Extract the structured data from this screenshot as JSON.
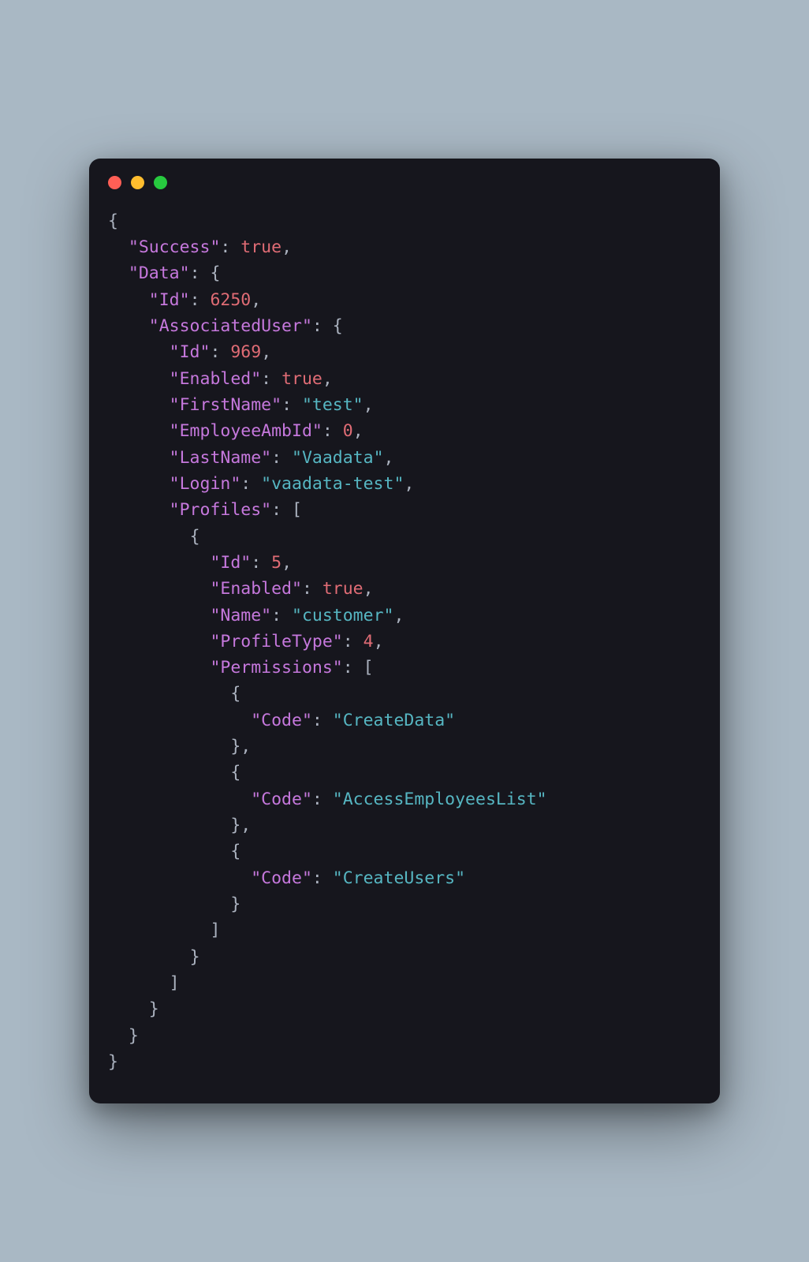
{
  "keys": {
    "success": "\"Success\"",
    "data": "\"Data\"",
    "id": "\"Id\"",
    "associatedUser": "\"AssociatedUser\"",
    "enabled": "\"Enabled\"",
    "firstName": "\"FirstName\"",
    "employeeAmbId": "\"EmployeeAmbId\"",
    "lastName": "\"LastName\"",
    "login": "\"Login\"",
    "profiles": "\"Profiles\"",
    "name": "\"Name\"",
    "profileType": "\"ProfileType\"",
    "permissions": "\"Permissions\"",
    "code": "\"Code\""
  },
  "vals": {
    "true": "true",
    "id1": "6250",
    "id2": "969",
    "firstName": "\"test\"",
    "zero": "0",
    "lastName": "\"Vaadata\"",
    "login": "\"vaadata-test\"",
    "profileId": "5",
    "customer": "\"customer\"",
    "profileType": "4",
    "perm1": "\"CreateData\"",
    "perm2": "\"AccessEmployeesList\"",
    "perm3": "\"CreateUsers\""
  },
  "colors": {
    "bg": "#16161d",
    "pageBg": "#a9b8c4",
    "key": "#c678dd",
    "string": "#56b6c2",
    "number": "#e06c75",
    "keyword": "#e06c75",
    "punct": "#abb2bf",
    "dotRed": "#ff5f56",
    "dotYellow": "#ffbd2e",
    "dotGreen": "#27c93f"
  }
}
